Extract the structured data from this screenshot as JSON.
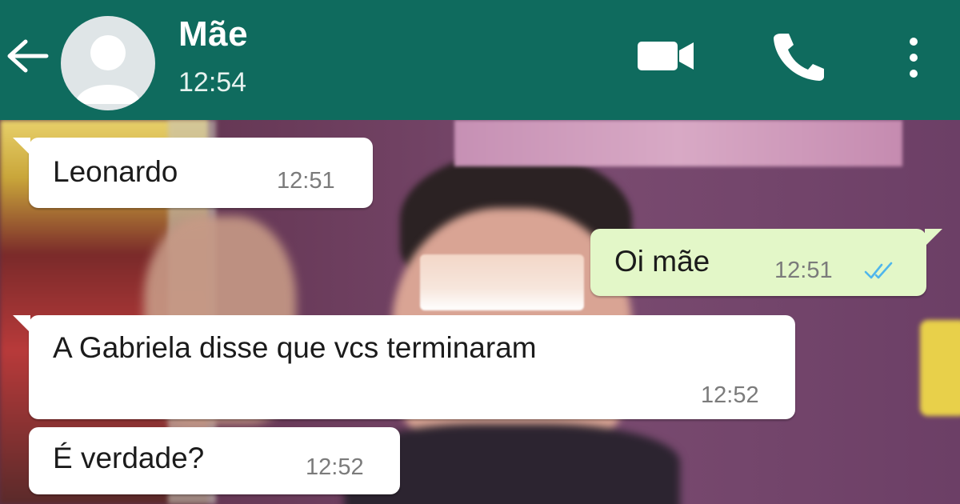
{
  "header": {
    "contact_name": "Mãe",
    "last_seen": "12:54",
    "icons": {
      "back": "arrow-left-icon",
      "avatar": "default-avatar-icon",
      "video": "video-call-icon",
      "call": "phone-icon",
      "menu": "more-vert-icon"
    }
  },
  "messages": [
    {
      "direction": "incoming",
      "text": "Leonardo",
      "time": "12:51"
    },
    {
      "direction": "outgoing",
      "text": "Oi mãe",
      "time": "12:51",
      "status": "read"
    },
    {
      "direction": "incoming",
      "text": "A Gabriela disse que vcs terminaram",
      "time": "12:52"
    },
    {
      "direction": "incoming",
      "text": "É verdade?",
      "time": "12:52"
    }
  ],
  "colors": {
    "header_bg": "#0f6b5e",
    "incoming_bubble": "#ffffff",
    "outgoing_bubble": "#e3f7c8",
    "read_ticks": "#4fb6ec"
  }
}
